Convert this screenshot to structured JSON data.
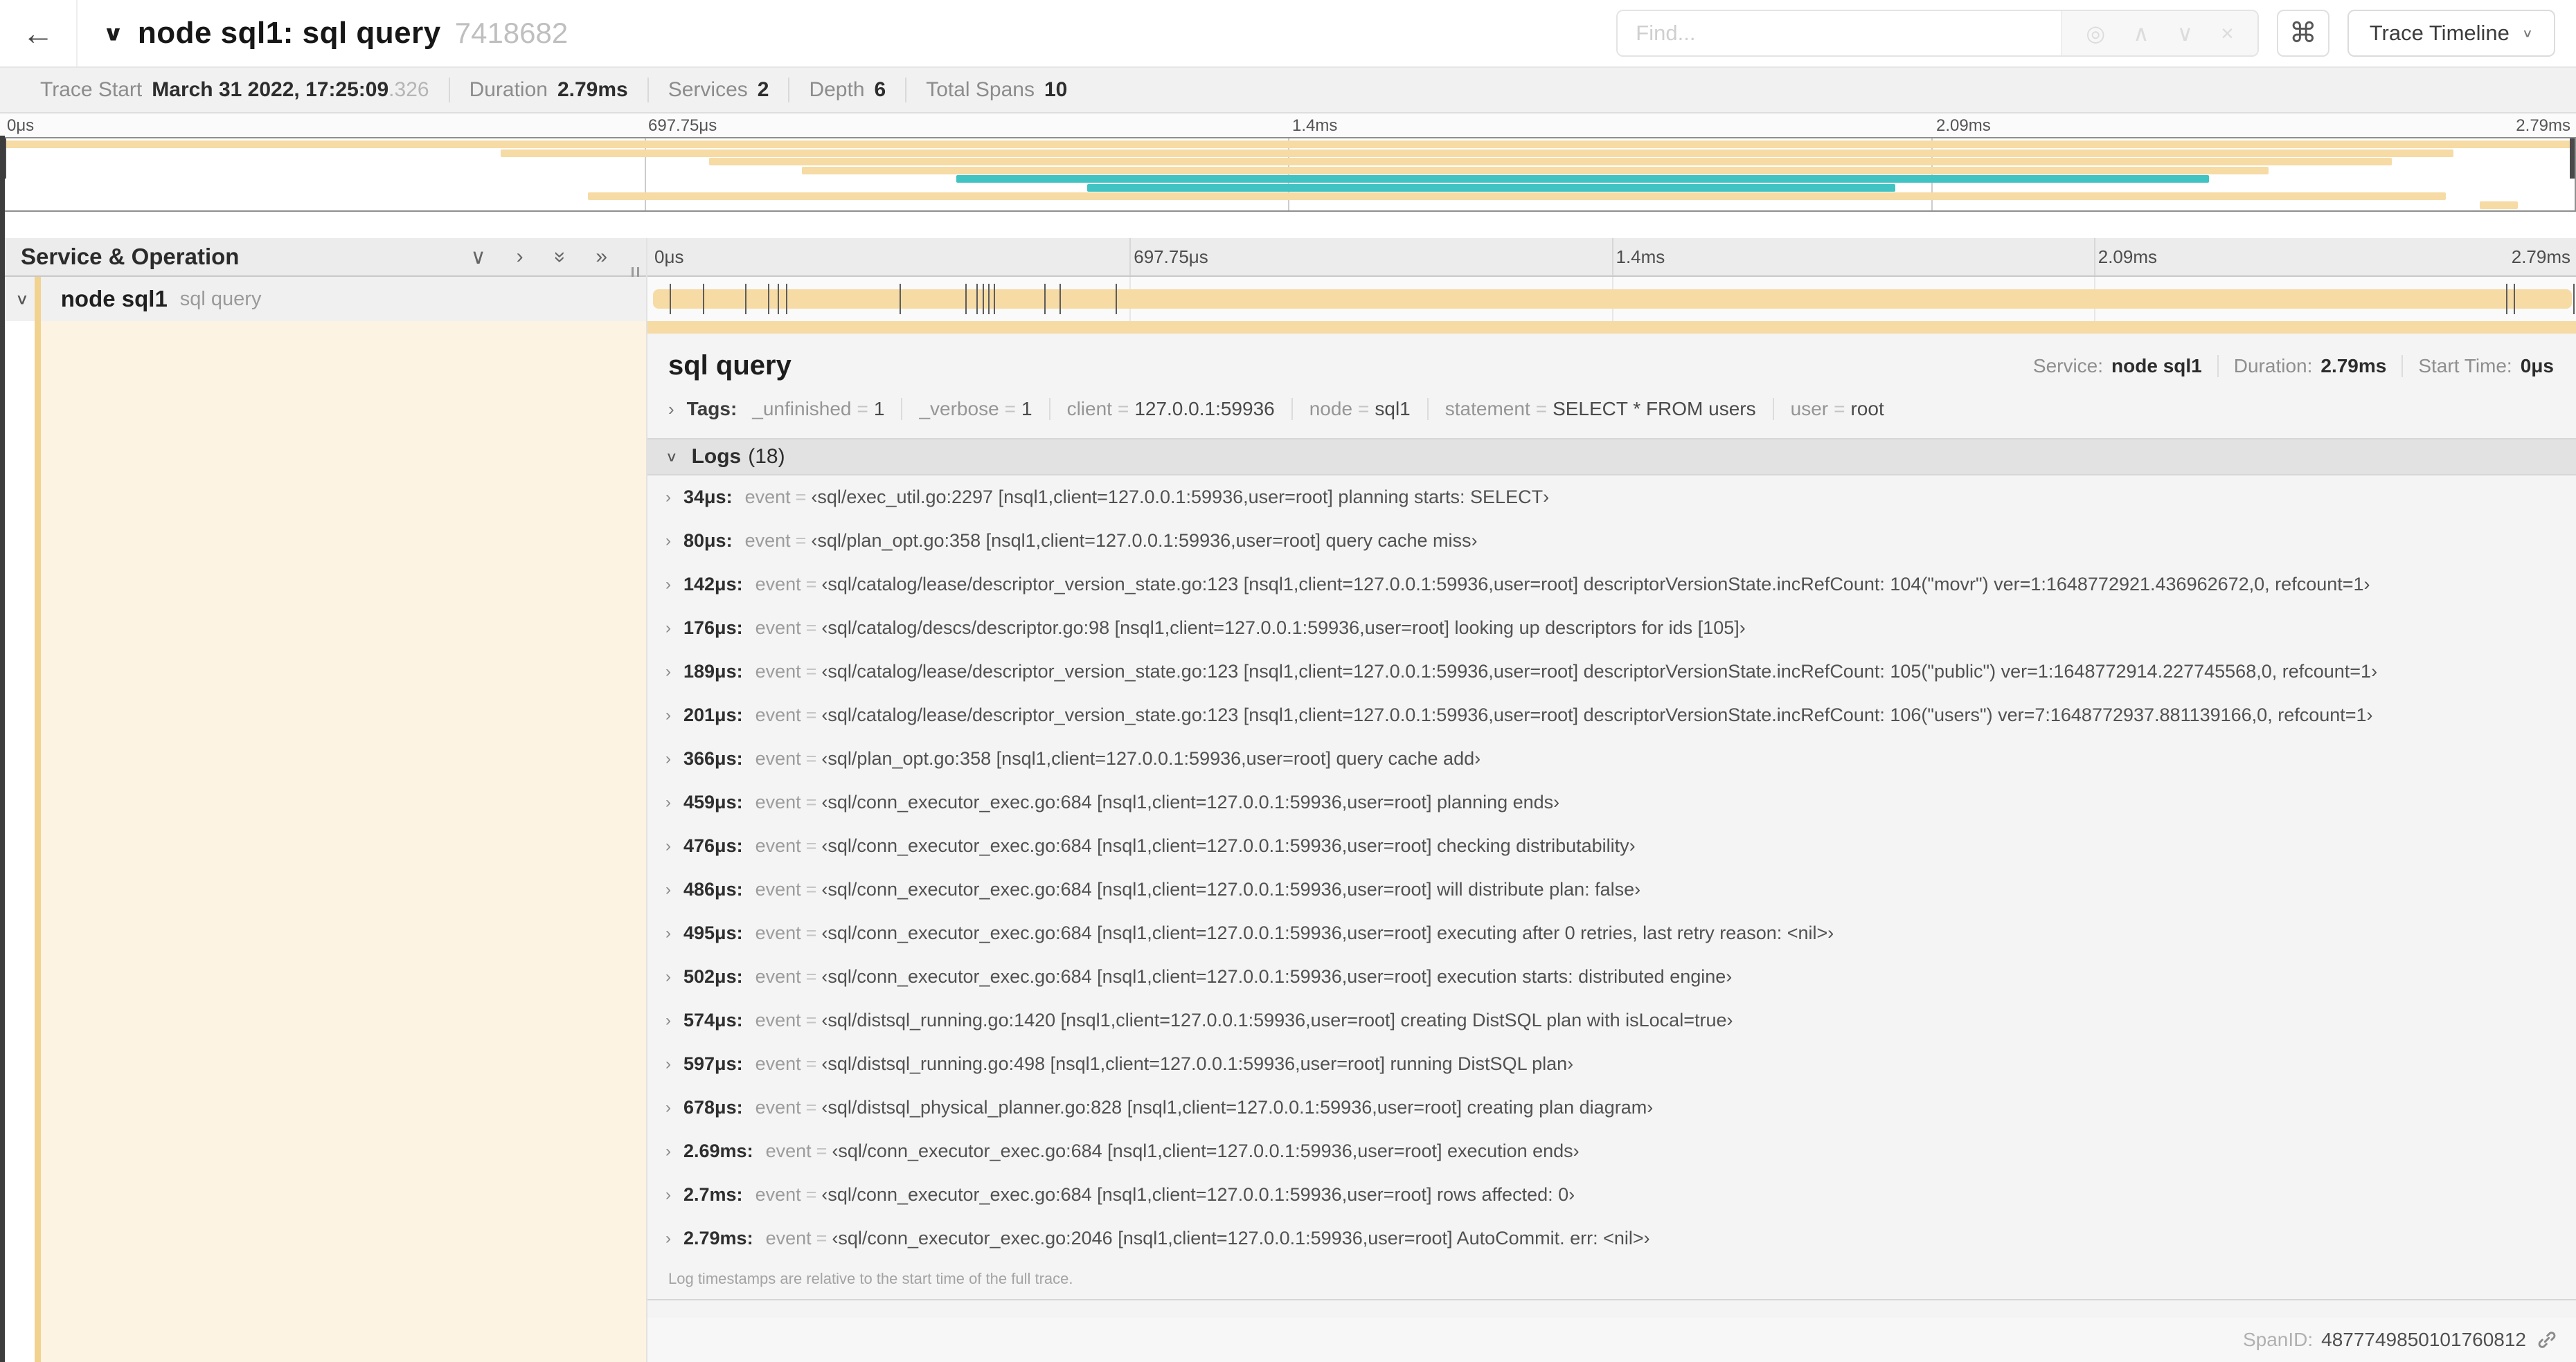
{
  "header": {
    "back_icon": "←",
    "collapse_icon": "∨",
    "title": "node sql1: sql query",
    "trace_id": "7418682",
    "find_placeholder": "Find...",
    "suffix_icons": [
      "◎",
      "∧",
      "∨",
      "×"
    ],
    "cmd_icon": "⌘",
    "view_button": "Trace Timeline"
  },
  "trace_info": {
    "trace_start_label": "Trace Start",
    "trace_start": "March 31 2022, 17:25:09",
    "trace_start_frac": ".326",
    "duration_label": "Duration",
    "duration": "2.79ms",
    "services_label": "Services",
    "services": "2",
    "depth_label": "Depth",
    "depth": "6",
    "total_spans_label": "Total Spans",
    "total_spans": "10"
  },
  "timeline_ticks": [
    "0μs",
    "697.75μs",
    "1.4ms",
    "2.09ms",
    "2.79ms"
  ],
  "minimap": {
    "spans": [
      {
        "start": 0,
        "end": 100,
        "color": "tan"
      },
      {
        "start": 19.4,
        "end": 95.3,
        "color": "tan"
      },
      {
        "start": 27.5,
        "end": 92.9,
        "color": "tan"
      },
      {
        "start": 31.1,
        "end": 88.1,
        "color": "tan"
      },
      {
        "start": 37.1,
        "end": 85.8,
        "color": "teal"
      },
      {
        "start": 42.2,
        "end": 73.6,
        "color": "teal"
      },
      {
        "start": 22.8,
        "end": 95.0,
        "color": "tan"
      },
      {
        "start": 96.3,
        "end": 97.8,
        "color": "tan"
      }
    ]
  },
  "left_panel": {
    "header": "Service & Operation",
    "icons": [
      "∨",
      "›",
      "»",
      "»"
    ],
    "row": {
      "chevron": "∨",
      "service": "node sql1",
      "operation": "sql query"
    }
  },
  "span_row": {
    "marker_fractions": [
      0.012,
      0.029,
      0.051,
      0.063,
      0.068,
      0.072,
      0.131,
      0.165,
      0.171,
      0.174,
      0.177,
      0.18,
      0.206,
      0.214,
      0.243,
      0.964,
      0.968,
      0.999
    ]
  },
  "detail": {
    "operation": "sql query",
    "service_label": "Service:",
    "service": "node sql1",
    "duration_label": "Duration:",
    "duration": "2.79ms",
    "start_label": "Start Time:",
    "start": "0μs",
    "tags_chevron": "›",
    "tags_label": "Tags:",
    "tags": [
      {
        "key": "_unfinished",
        "value": "1"
      },
      {
        "key": "_verbose",
        "value": "1"
      },
      {
        "key": "client",
        "value": "127.0.0.1:59936"
      },
      {
        "key": "node",
        "value": "sql1"
      },
      {
        "key": "statement",
        "value": "SELECT * FROM users"
      },
      {
        "key": "user",
        "value": "root"
      }
    ],
    "logs_chevron": "∨",
    "logs_label": "Logs",
    "logs_count": "(18)",
    "log_event_key": "event",
    "log_eq": "=",
    "logs": [
      {
        "time": "34μs:",
        "event": "‹sql/exec_util.go:2297 [nsql1,client=127.0.0.1:59936,user=root] planning starts: SELECT›"
      },
      {
        "time": "80μs:",
        "event": "‹sql/plan_opt.go:358 [nsql1,client=127.0.0.1:59936,user=root] query cache miss›"
      },
      {
        "time": "142μs:",
        "event": "‹sql/catalog/lease/descriptor_version_state.go:123 [nsql1,client=127.0.0.1:59936,user=root] descriptorVersionState.incRefCount: 104(\"movr\") ver=1:1648772921.436962672,0, refcount=1›"
      },
      {
        "time": "176μs:",
        "event": "‹sql/catalog/descs/descriptor.go:98 [nsql1,client=127.0.0.1:59936,user=root] looking up descriptors for ids [105]›"
      },
      {
        "time": "189μs:",
        "event": "‹sql/catalog/lease/descriptor_version_state.go:123 [nsql1,client=127.0.0.1:59936,user=root] descriptorVersionState.incRefCount: 105(\"public\") ver=1:1648772914.227745568,0, refcount=1›"
      },
      {
        "time": "201μs:",
        "event": "‹sql/catalog/lease/descriptor_version_state.go:123 [nsql1,client=127.0.0.1:59936,user=root] descriptorVersionState.incRefCount: 106(\"users\") ver=7:1648772937.881139166,0, refcount=1›"
      },
      {
        "time": "366μs:",
        "event": "‹sql/plan_opt.go:358 [nsql1,client=127.0.0.1:59936,user=root] query cache add›"
      },
      {
        "time": "459μs:",
        "event": "‹sql/conn_executor_exec.go:684 [nsql1,client=127.0.0.1:59936,user=root] planning ends›"
      },
      {
        "time": "476μs:",
        "event": "‹sql/conn_executor_exec.go:684 [nsql1,client=127.0.0.1:59936,user=root] checking distributability›"
      },
      {
        "time": "486μs:",
        "event": "‹sql/conn_executor_exec.go:684 [nsql1,client=127.0.0.1:59936,user=root] will distribute plan: false›"
      },
      {
        "time": "495μs:",
        "event": "‹sql/conn_executor_exec.go:684 [nsql1,client=127.0.0.1:59936,user=root] executing after 0 retries, last retry reason: <nil>›"
      },
      {
        "time": "502μs:",
        "event": "‹sql/conn_executor_exec.go:684 [nsql1,client=127.0.0.1:59936,user=root] execution starts: distributed engine›"
      },
      {
        "time": "574μs:",
        "event": "‹sql/distsql_running.go:1420 [nsql1,client=127.0.0.1:59936,user=root] creating DistSQL plan with isLocal=true›"
      },
      {
        "time": "597μs:",
        "event": "‹sql/distsql_running.go:498 [nsql1,client=127.0.0.1:59936,user=root] running DistSQL plan›"
      },
      {
        "time": "678μs:",
        "event": "‹sql/distsql_physical_planner.go:828 [nsql1,client=127.0.0.1:59936,user=root] creating plan diagram›"
      },
      {
        "time": "2.69ms:",
        "event": "‹sql/conn_executor_exec.go:684 [nsql1,client=127.0.0.1:59936,user=root] execution ends›"
      },
      {
        "time": "2.7ms:",
        "event": "‹sql/conn_executor_exec.go:684 [nsql1,client=127.0.0.1:59936,user=root] rows affected: 0›"
      },
      {
        "time": "2.79ms:",
        "event": "‹sql/conn_executor_exec.go:2046 [nsql1,client=127.0.0.1:59936,user=root] AutoCommit. err: <nil>›"
      }
    ],
    "footnote": "Log timestamps are relative to the start time of the full trace.",
    "spanid_label": "SpanID:",
    "spanid": "4877749850101760812"
  },
  "colors": {
    "span_tan": "#f6dba5",
    "span_teal": "#41c3c3",
    "detail_cream": "#fdf3e2",
    "accent": "#f1d28f"
  }
}
